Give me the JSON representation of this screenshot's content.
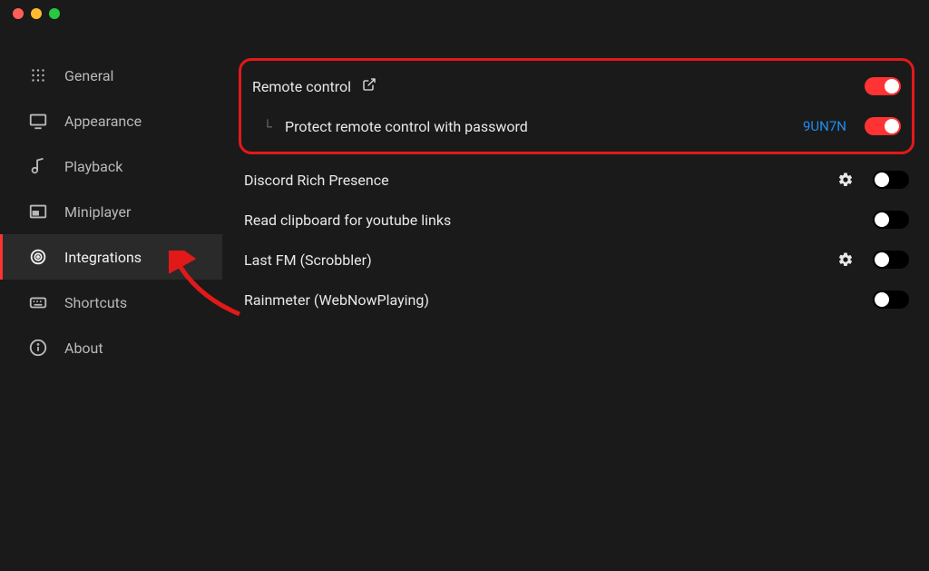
{
  "sidebar": {
    "items": [
      {
        "label": "General",
        "icon": "dots-grid"
      },
      {
        "label": "Appearance",
        "icon": "monitor"
      },
      {
        "label": "Playback",
        "icon": "music-note"
      },
      {
        "label": "Miniplayer",
        "icon": "pip"
      },
      {
        "label": "Integrations",
        "icon": "target",
        "active": true
      },
      {
        "label": "Shortcuts",
        "icon": "keyboard"
      },
      {
        "label": "About",
        "icon": "info"
      }
    ]
  },
  "integrations": {
    "remote_control": {
      "label": "Remote control",
      "on": true
    },
    "remote_password": {
      "label": "Protect remote control with password",
      "code": "9UN7N",
      "on": true
    },
    "discord": {
      "label": "Discord Rich Presence",
      "has_gear": true,
      "on": false
    },
    "clipboard": {
      "label": "Read clipboard for youtube links",
      "on": false
    },
    "lastfm": {
      "label": "Last FM (Scrobbler)",
      "has_gear": true,
      "on": false
    },
    "rainmeter": {
      "label": "Rainmeter (WebNowPlaying)",
      "on": false
    }
  },
  "colors": {
    "accent": "#ff3333",
    "link": "#1f8df0",
    "highlight": "#e21919"
  }
}
